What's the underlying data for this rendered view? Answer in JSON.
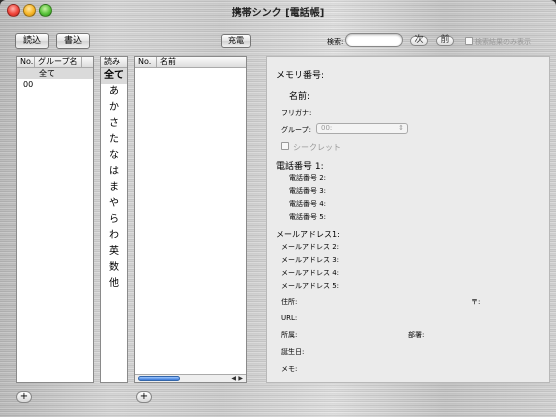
{
  "window": {
    "title": "携帯シンク [電話帳]"
  },
  "toolbar": {
    "read_label": "読込",
    "write_label": "書込",
    "charge_label": "充電"
  },
  "search": {
    "label": "検索:",
    "value": "",
    "next_label": "次",
    "prev_label": "前",
    "results_only_label": "検索結果のみ表示"
  },
  "groups": {
    "headers": [
      "No.",
      "グループ名"
    ],
    "rows": [
      {
        "no": "",
        "name": "全て",
        "selected": true
      },
      {
        "no": "00",
        "name": "",
        "selected": false
      }
    ]
  },
  "kana": {
    "header": "読み",
    "items": [
      "全て",
      "あ",
      "か",
      "さ",
      "た",
      "な",
      "は",
      "ま",
      "や",
      "ら",
      "わ",
      "英",
      "数",
      "他"
    ]
  },
  "names": {
    "headers": [
      "No.",
      "名前"
    ]
  },
  "detail": {
    "memory_no_label": "メモリ番号:",
    "name_label": "名前:",
    "furigana_label": "フリガナ:",
    "group_label": "グループ:",
    "group_value": "00:",
    "secret_label": "シークレット",
    "phone1_label": "電話番号 1:",
    "phone2_label": "電話番号 2:",
    "phone3_label": "電話番号 3:",
    "phone4_label": "電話番号 4:",
    "phone5_label": "電話番号 5:",
    "mail1_label": "メールアドレス1:",
    "mail2_label": "メールアドレス 2:",
    "mail3_label": "メールアドレス 3:",
    "mail4_label": "メールアドレス 4:",
    "mail5_label": "メールアドレス 5:",
    "address_label": "住所:",
    "postal_label": "〒:",
    "url_label": "URL:",
    "company_label": "所属:",
    "department_label": "部署:",
    "birthday_label": "誕生日:",
    "memo_label": "メモ:"
  },
  "footer": {
    "add_group_label": "+",
    "add_name_label": "+"
  }
}
